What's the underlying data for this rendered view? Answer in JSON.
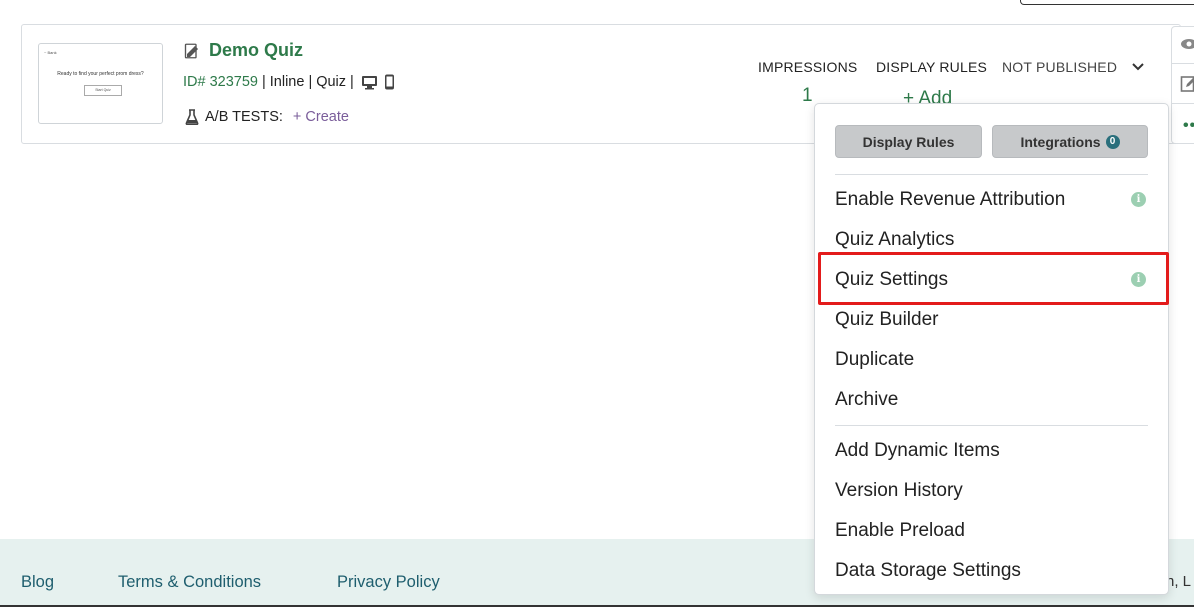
{
  "quiz": {
    "title": "Demo Quiz",
    "id_text": "ID# 323759",
    "type_inline": "Inline",
    "type_quiz": "Quiz",
    "separator": "|",
    "ab_tests_label": "A/B TESTS:",
    "ab_create_link": "+ Create",
    "thumbnail": {
      "logo_text": "~ Bank",
      "headline": "Ready to find your perfect prom dress?",
      "button": "Start Quiz"
    }
  },
  "stats": {
    "impressions_label": "IMPRESSIONS",
    "impressions_value": "1",
    "display_rules_label": "DISPLAY RULES",
    "display_rules_value": "+ Add",
    "status_label": "NOT PUBLISHED"
  },
  "dropdown": {
    "display_rules_button": "Display Rules",
    "integrations_button": "Integrations",
    "integrations_count": "0",
    "items_group1": [
      "Enable Revenue Attribution",
      "Quiz Analytics",
      "Quiz Settings",
      "Quiz Builder",
      "Duplicate",
      "Archive"
    ],
    "items_group2": [
      "Add Dynamic Items",
      "Version History",
      "Enable Preload",
      "Data Storage Settings"
    ],
    "info_glyph": "i"
  },
  "footer": {
    "links": [
      "Blog",
      "Terms & Conditions",
      "Privacy Policy"
    ],
    "cut_text": "h, L"
  },
  "colors": {
    "accent_green": "#2e7a4a",
    "footer_bg": "#e6f1ef",
    "highlight": "#e31b1b",
    "badge": "#2a6f7c"
  }
}
